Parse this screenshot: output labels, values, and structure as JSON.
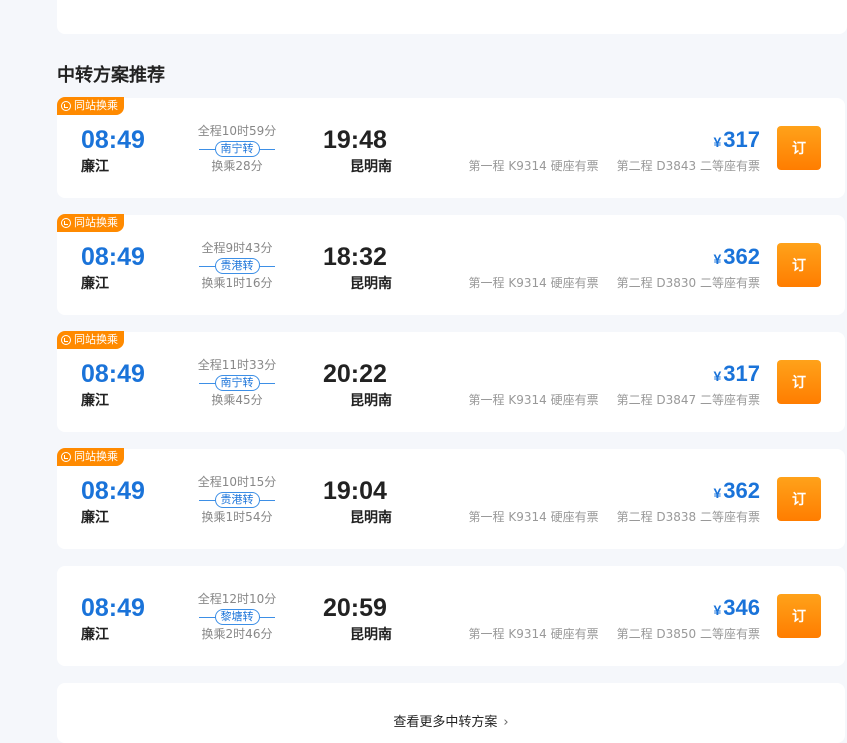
{
  "section_title": "中转方案推荐",
  "tag_label": "同站换乘",
  "book_label": "订",
  "more_label": "查看更多中转方案",
  "price_symbol": "¥",
  "routes": [
    {
      "tag": true,
      "dep_time": "08:49",
      "dep_station": "廉江",
      "duration": "全程10时59分",
      "transfer": "南宁转",
      "wait": "换乘28分",
      "arr_time": "19:48",
      "arr_station": "昆明南",
      "price": "317",
      "leg1": "第一程 K9314 硬座有票",
      "leg2": "第二程 D3843 二等座有票"
    },
    {
      "tag": true,
      "dep_time": "08:49",
      "dep_station": "廉江",
      "duration": "全程9时43分",
      "transfer": "贵港转",
      "wait": "换乘1时16分",
      "arr_time": "18:32",
      "arr_station": "昆明南",
      "price": "362",
      "leg1": "第一程 K9314 硬座有票",
      "leg2": "第二程 D3830 二等座有票"
    },
    {
      "tag": true,
      "dep_time": "08:49",
      "dep_station": "廉江",
      "duration": "全程11时33分",
      "transfer": "南宁转",
      "wait": "换乘45分",
      "arr_time": "20:22",
      "arr_station": "昆明南",
      "price": "317",
      "leg1": "第一程 K9314 硬座有票",
      "leg2": "第二程 D3847 二等座有票"
    },
    {
      "tag": true,
      "dep_time": "08:49",
      "dep_station": "廉江",
      "duration": "全程10时15分",
      "transfer": "贵港转",
      "wait": "换乘1时54分",
      "arr_time": "19:04",
      "arr_station": "昆明南",
      "price": "362",
      "leg1": "第一程 K9314 硬座有票",
      "leg2": "第二程 D3838 二等座有票"
    },
    {
      "tag": false,
      "dep_time": "08:49",
      "dep_station": "廉江",
      "duration": "全程12时10分",
      "transfer": "黎塘转",
      "wait": "换乘2时46分",
      "arr_time": "20:59",
      "arr_station": "昆明南",
      "price": "346",
      "leg1": "第一程 K9314 硬座有票",
      "leg2": "第二程 D3850 二等座有票"
    }
  ],
  "colors": {
    "accent": "#1a73d9",
    "tag": "#ff8a00",
    "button": "#ff8a00"
  },
  "icons": {
    "tag_icon": "transfer-circle-icon",
    "more_icon": "chevron-right-icon"
  }
}
